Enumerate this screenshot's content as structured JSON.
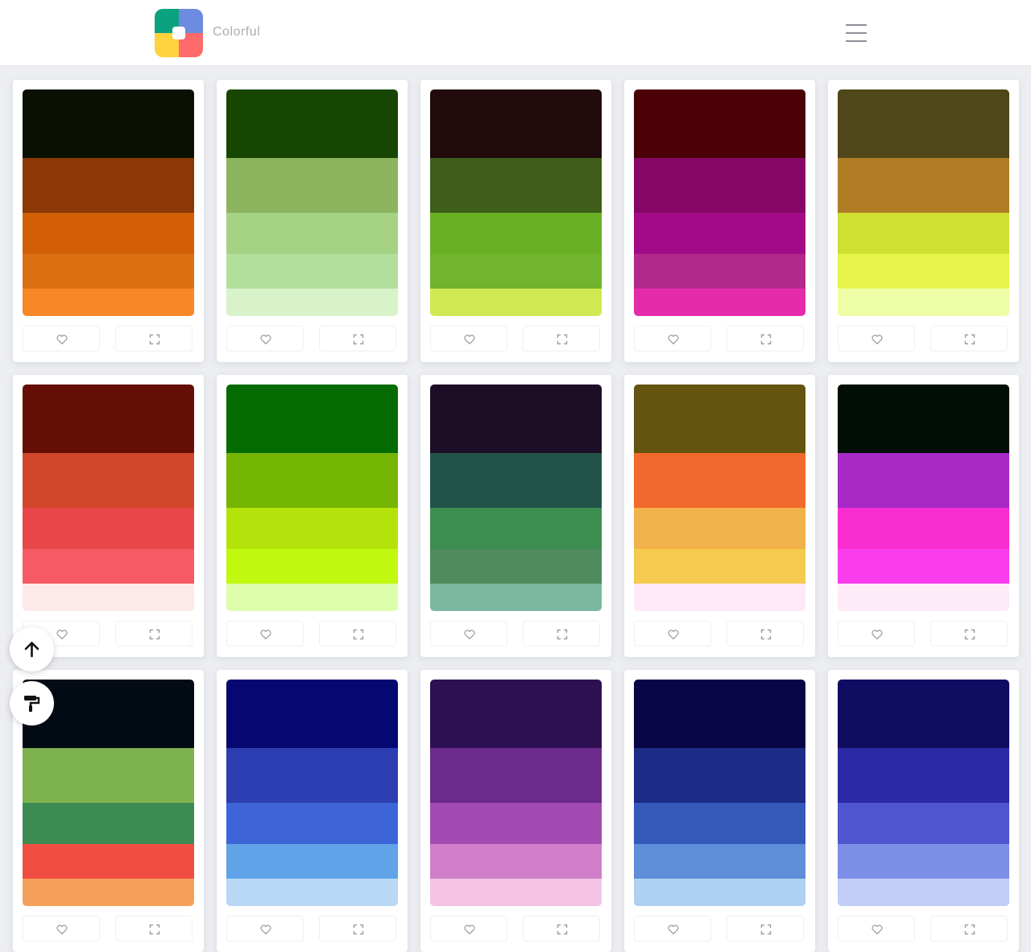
{
  "header": {
    "brand": "Colorful",
    "logo_colors": [
      "#0ba37f",
      "#6d8be0",
      "#ffd23f",
      "#ff6b6b"
    ]
  },
  "icons": {
    "menu": "hamburger-menu-icon",
    "like": "heart-icon",
    "expand": "expand-icon",
    "scroll_top": "arrow-up-icon",
    "theme": "paint-roller-icon"
  },
  "palettes": [
    [
      "#0b1102",
      "#8b3804",
      "#d25f05",
      "#db7012",
      "#f68828"
    ],
    [
      "#164602",
      "#8bb45c",
      "#a6d285",
      "#b3df9c",
      "#d8f3c9"
    ],
    [
      "#210b0d",
      "#3e5e1a",
      "#68b024",
      "#70b52d",
      "#d0e953"
    ],
    [
      "#4b0006",
      "#860766",
      "#a20b87",
      "#b12a8b",
      "#e42cab"
    ],
    [
      "#4f4619",
      "#b07c25",
      "#cfe033",
      "#e6f44b",
      "#eefea6"
    ],
    [
      "#650e06",
      "#d2462b",
      "#e74748",
      "#f65a64",
      "#fde9e9"
    ],
    [
      "#056b03",
      "#75b503",
      "#b4e30b",
      "#c0f90f",
      "#ddfeab"
    ],
    [
      "#1c0e27",
      "#225349",
      "#3d8d50",
      "#4f8b5d",
      "#7bb8a0"
    ],
    [
      "#655410",
      "#f1692d",
      "#f2b24b",
      "#f4ca4f",
      "#fde9f7"
    ],
    [
      "#010e05",
      "#a72ac7",
      "#f82dd0",
      "#f93ded",
      "#fdebf8"
    ],
    [
      "#030b14",
      "#7db24e",
      "#3b8b53",
      "#f04d43",
      "#f5a05a"
    ],
    [
      "#050870",
      "#2c3eb1",
      "#3d65d8",
      "#60a3e8",
      "#b8d8f6"
    ],
    [
      "#2d1052",
      "#6b2a8c",
      "#a44ab3",
      "#d07ec9",
      "#f4c3e3"
    ],
    [
      "#080646",
      "#1d2c87",
      "#3558bb",
      "#5f8ed9",
      "#aed0f1"
    ],
    [
      "#100c62",
      "#2d2aa5",
      "#4f56d0",
      "#7d8ee7",
      "#c1ccf7"
    ]
  ]
}
